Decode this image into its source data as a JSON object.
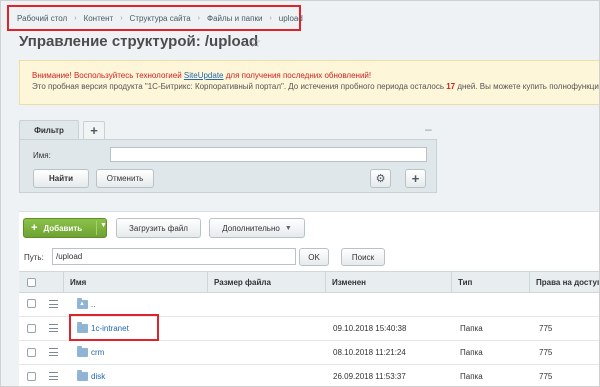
{
  "breadcrumb": [
    "Рабочий стол",
    "Контент",
    "Структура сайта",
    "Файлы и папки",
    "upload"
  ],
  "breadcrumb_separator": "›",
  "page_title": "Управление структурой: /upload",
  "notice": {
    "line1_prefix": "Внимание! Воспользуйтесь технологией ",
    "line1_link": "SiteUpdate",
    "line1_suffix": " для получения последних обновлений!",
    "line2_prefix": "Это пробная версия продукта \"1С-Битрикс: Корпоративный портал\". До истечения пробного периода осталось ",
    "line2_days": "17",
    "line2_suffix": " дней. Вы можете купить полнофункциональную версию"
  },
  "filter": {
    "tab_label": "Фильтр",
    "name_label": "Имя:",
    "name_value": "",
    "find_button": "Найти",
    "cancel_button": "Отменить"
  },
  "toolbar": {
    "add_button": "Добавить",
    "upload_button": "Загрузить файл",
    "more_button": "Дополнительно"
  },
  "path": {
    "label": "Путь:",
    "value": "/upload",
    "ok_button": "OK",
    "search_button": "Поиск"
  },
  "table": {
    "headers": {
      "name": "Имя",
      "size": "Размер файла",
      "modified": "Изменен",
      "type": "Тип",
      "rights": "Права на доступ"
    },
    "rows": [
      {
        "name": "..",
        "modified": "",
        "type": "",
        "rights": ""
      },
      {
        "name": "1c-intranet",
        "modified": "09.10.2018 15:40:38",
        "type": "Папка",
        "rights": "775"
      },
      {
        "name": "crm",
        "modified": "08.10.2018 11:21:24",
        "type": "Папка",
        "rights": "775"
      },
      {
        "name": "disk",
        "modified": "26.09.2018 11:53:37",
        "type": "Папка",
        "rights": "775"
      }
    ]
  },
  "colors": {
    "highlight": "#e0232a",
    "accent_green": "#7cb342",
    "link": "#2067b0",
    "warning_red": "#d21f1f"
  },
  "icons": {
    "star": "star-icon",
    "gear": "gear-icon",
    "folder": "folder-icon",
    "menu": "hamburger-menu-icon"
  }
}
